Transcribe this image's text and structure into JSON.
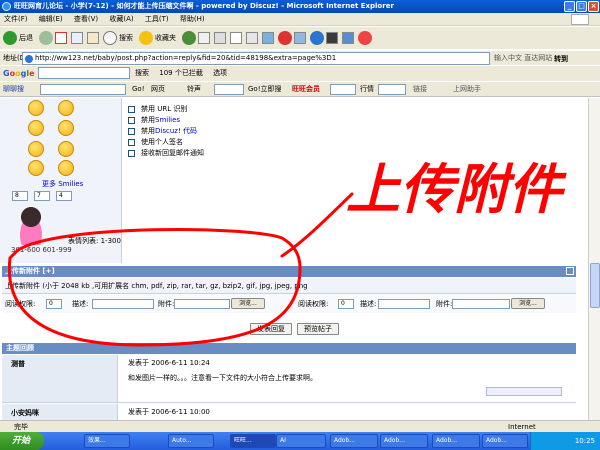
{
  "window": {
    "title": "旺旺网育儿论坛 - 小学(7-12) - 如何才能上传压缩文件啊 - powered by Discuz! - Microsoft Internet Explorer"
  },
  "menu": [
    "文件(F)",
    "编辑(E)",
    "查看(V)",
    "收藏(A)",
    "工具(T)",
    "帮助(H)"
  ],
  "toolbar": {
    "back": "后退",
    "search": "搜索",
    "favorites": "收藏夹"
  },
  "address": {
    "label": "地址(D)",
    "url": "http://ww123.net/baby/post.php?action=reply&fid=20&tid=48198&extra=page%3D1",
    "ime_hint": "输入中文 直达网站",
    "go": "转到"
  },
  "google": {
    "logo": "Google",
    "search": "搜索",
    "blocked": "109 个已拦截",
    "options": "选项"
  },
  "chatbar": {
    "label": "聊聊搜",
    "go": "Go!",
    "web": "网页",
    "music": "铃声",
    "go_search": "Go!立即搜",
    "tag": "旺旺会员",
    "line": "行情",
    "links": "链接",
    "helper": "上网助手"
  },
  "faces": {
    "more": "更多 Smilies",
    "list": "表情列表: 1-300",
    "range": "301-600 601-999",
    "pages": [
      "8",
      "7",
      "4"
    ]
  },
  "options": [
    {
      "label": "禁用 URL 识别",
      "highlight": ""
    },
    {
      "label": "禁用 ",
      "highlight": "Smilies"
    },
    {
      "label": "禁用 ",
      "highlight": "Discuz! 代码"
    },
    {
      "label": "使用个人签名",
      "highlight": ""
    },
    {
      "label": "接收新回复邮件通知",
      "highlight": ""
    }
  ],
  "annotation": {
    "text": "上传附件",
    "color": "#ff0000"
  },
  "attachments": {
    "header": "上传新附件 [+]",
    "info": "上传新附件 (小于 2048 kb ,可用扩展名 chm, pdf, zip, rar, tar, gz, bzip2, gif, jpg, jpeg, png",
    "read_label": "阅读权限:",
    "read_value": "0",
    "desc_label": "描述:",
    "file_label": "附件:",
    "browse": "浏览..."
  },
  "buttons": {
    "submit": "发表回复",
    "preview": "预览帖子"
  },
  "review": {
    "header": "主题回顾",
    "posts": [
      {
        "author": "测普",
        "meta": "发表于  2006-6-11 10:24",
        "body": "和发图片一样的。。。注意看一下文件的大小符合上传要求啊。"
      },
      {
        "author": "小安妈咪",
        "meta": "发表于  2006-6-11 10:00",
        "body": ""
      }
    ]
  },
  "status": {
    "left": "完毕",
    "zone": "Internet"
  },
  "taskbar": {
    "start": "开始",
    "tasks": [
      "效果...",
      "Auto...",
      "旺旺...",
      "AI",
      "Adob...",
      "Adob...",
      "Adob...",
      "Adob..."
    ],
    "clock": "10:25"
  }
}
